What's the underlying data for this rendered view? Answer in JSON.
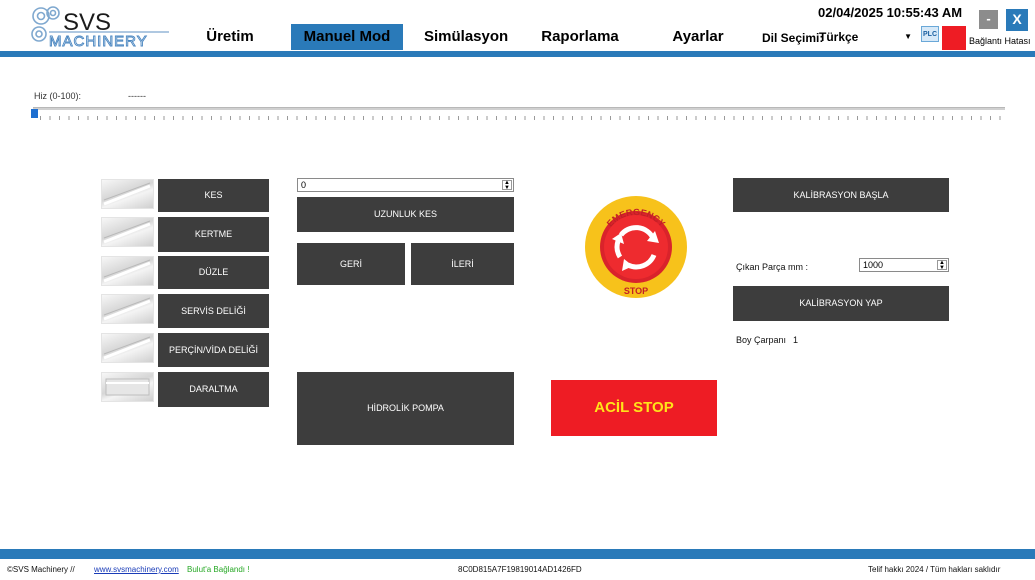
{
  "header": {
    "logo_top": "SVS",
    "logo_bottom": "MACHINERY",
    "tabs": [
      {
        "label": "Üretim",
        "active": false
      },
      {
        "label": "Manuel Mod",
        "active": true
      },
      {
        "label": "Simülasyon",
        "active": false
      },
      {
        "label": "Raporlama",
        "active": false
      },
      {
        "label": "Ayarlar",
        "active": false
      }
    ],
    "datetime": "02/04/2025 10:55:43 AM",
    "language_label": "Dil Seçimi:",
    "language_value": "Türkçe",
    "plc_label": "PLC",
    "minimize_label": "-",
    "close_label": "X",
    "connection_status": "Bağlantı Hatası",
    "accent_color": "#2a7ab9",
    "error_color": "#ee1c24"
  },
  "speed": {
    "label": "Hiz (0-100):",
    "value": "------",
    "level": 0
  },
  "operations": [
    {
      "label": "KES",
      "icon": "profile-icon"
    },
    {
      "label": "KERTME",
      "icon": "profile-icon"
    },
    {
      "label": "DÜZLE",
      "icon": "profile-icon"
    },
    {
      "label": "SERVİS DELİĞİ",
      "icon": "profile-icon"
    },
    {
      "label": "PERÇİN/VİDA DELİĞİ",
      "icon": "profile-icon"
    },
    {
      "label": "DARALTMA",
      "icon": "profile-icon"
    }
  ],
  "cutting": {
    "length_value": "0",
    "cut_length_label": "UZUNLUK KES",
    "back_label": "GERİ",
    "forward_label": "İLERİ",
    "hydraulic_label": "HİDROLİK POMPA"
  },
  "emergency": {
    "icon_text_top": "EMERGENCY",
    "icon_text_bottom": "STOP",
    "button_label": "ACİL STOP"
  },
  "calibration": {
    "start_label": "KALİBRASYON BAŞLA",
    "part_label": "Çıkan Parça mm :",
    "part_value": "1000",
    "do_label": "KALİBRASYON YAP",
    "multiplier_label": "Boy Çarpanı",
    "multiplier_value": "1"
  },
  "footer": {
    "company": "©SVS Machinery //",
    "website": "www.svsmachinery.com",
    "cloud_status": "Bulut'a Bağlandı !",
    "device_id": "8C0D815A7F19819014AD1426FD",
    "copyright": "Telif hakkı 2024 / Tüm hakları saklıdır"
  }
}
